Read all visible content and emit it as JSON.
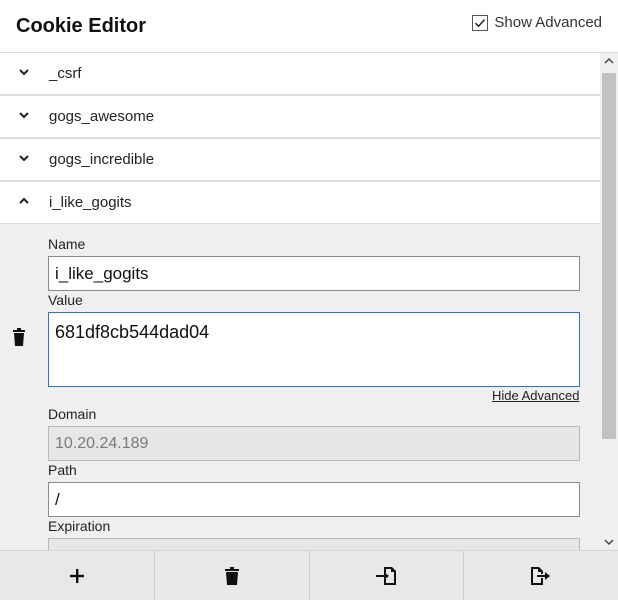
{
  "header": {
    "title": "Cookie Editor",
    "show_advanced_label": "Show Advanced",
    "show_advanced_checked": true
  },
  "cookies": [
    {
      "name": "_csrf",
      "expanded": false
    },
    {
      "name": "gogs_awesome",
      "expanded": false
    },
    {
      "name": "gogs_incredible",
      "expanded": false
    },
    {
      "name": "i_like_gogits",
      "expanded": true
    }
  ],
  "details": {
    "name_label": "Name",
    "name_value": "i_like_gogits",
    "value_label": "Value",
    "value_value": "681df8cb544dad04",
    "hide_advanced_label": "Hide Advanced",
    "domain_label": "Domain",
    "domain_value": "10.20.24.189",
    "path_label": "Path",
    "path_value": "/",
    "expiration_label": "Expiration"
  },
  "footer": {
    "buttons": [
      "plus-icon",
      "trash-icon",
      "import-icon",
      "export-icon"
    ]
  }
}
